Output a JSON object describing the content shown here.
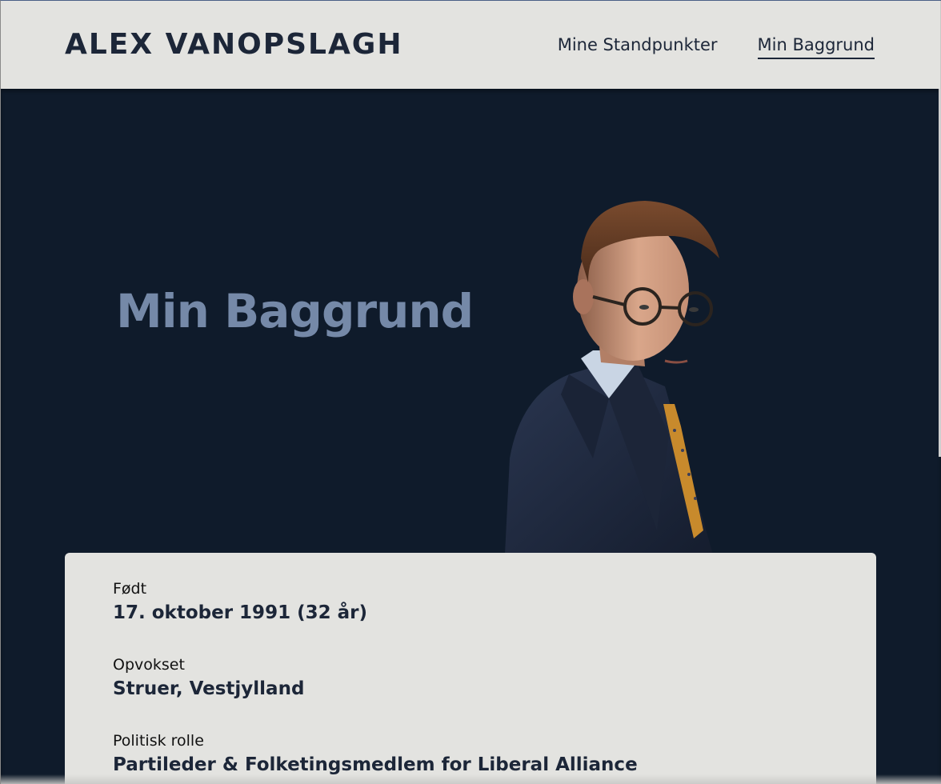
{
  "header": {
    "logo": "ALEX VANOPSLAGH",
    "nav": [
      {
        "label": "Mine Standpunkter",
        "active": false
      },
      {
        "label": "Min Baggrund",
        "active": true
      }
    ]
  },
  "hero": {
    "title": "Min Baggrund",
    "portrait_alt": "Portrait photo"
  },
  "facts": [
    {
      "label": "Født",
      "value": "17. oktober 1991 (32 år)"
    },
    {
      "label": "Opvokset",
      "value": "Struer, Vestjylland"
    },
    {
      "label": "Politisk rolle",
      "value": "Partileder & Folketingsmedlem for Liberal Alliance"
    }
  ],
  "colors": {
    "navy": "#0f1b2b",
    "light": "#e3e3e0",
    "text_dark": "#1c2638",
    "title_accent": "#7589a8"
  }
}
